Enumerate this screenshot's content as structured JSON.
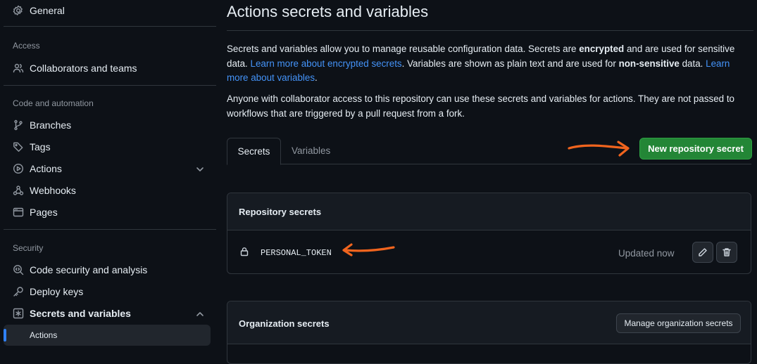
{
  "sidebar": {
    "general": "General",
    "access_label": "Access",
    "collaborators": "Collaborators and teams",
    "code_automation_label": "Code and automation",
    "branches": "Branches",
    "tags": "Tags",
    "actions": "Actions",
    "webhooks": "Webhooks",
    "pages": "Pages",
    "security_label": "Security",
    "code_security": "Code security and analysis",
    "deploy_keys": "Deploy keys",
    "secrets_variables": "Secrets and variables",
    "sub_actions": "Actions"
  },
  "main": {
    "title": "Actions secrets and variables",
    "desc1": {
      "t1": "Secrets and variables allow you to manage reusable configuration data. Secrets are ",
      "b1": "encrypted",
      "t2": " and are used for sensitive data. ",
      "link1": "Learn more about encrypted secrets",
      "t3": ". Variables are shown as plain text and are used for ",
      "b2": "non-sensitive",
      "t4": " data. ",
      "link2": "Learn more about variables",
      "t5": "."
    },
    "desc2": "Anyone with collaborator access to this repository can use these secrets and variables for actions. They are not passed to workflows that are triggered by a pull request from a fork.",
    "tabs": {
      "secrets": "Secrets",
      "variables": "Variables"
    },
    "new_secret_button": "New repository secret",
    "repo_secrets": {
      "heading": "Repository secrets",
      "secret_name": "PERSONAL_TOKEN",
      "updated": "Updated now"
    },
    "org_secrets": {
      "heading": "Organization secrets",
      "manage_button": "Manage organization secrets"
    }
  },
  "colors": {
    "accent_green": "#238636",
    "link": "#4493f8",
    "annotation_arrow": "#f0641e",
    "active_bar": "#2f81f7"
  }
}
